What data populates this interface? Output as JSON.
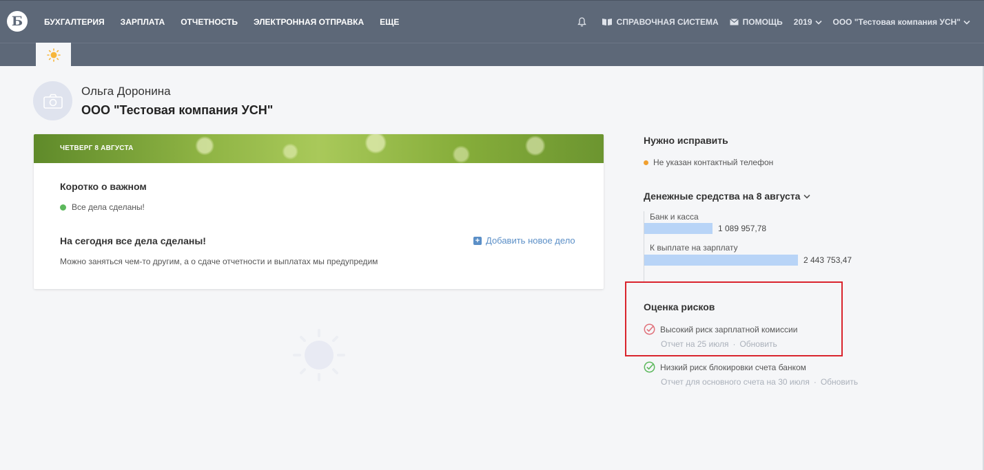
{
  "header": {
    "logo_letter": "Б",
    "nav": [
      "БУХГАЛТЕРИЯ",
      "ЗАРПЛАТА",
      "ОТЧЕТНОСТЬ",
      "ЭЛЕКТРОННАЯ ОТПРАВКА",
      "ЕЩЕ"
    ],
    "reference_label": "СПРАВОЧНАЯ СИСТЕМА",
    "help_label": "ПОМОЩЬ",
    "year": "2019",
    "company": "ООО \"Тестовая компания УСН\""
  },
  "profile": {
    "user_name": "Ольга Доронина",
    "company_name": "ООО \"Тестовая компания УСН\""
  },
  "day_card": {
    "date": "ЧЕТВЕРГ 8 АВГУСТА",
    "important_title": "Коротко о важном",
    "all_done": "Все дела сделаны!",
    "today_title": "На сегодня все дела сделаны!",
    "add_task": "Добавить новое дело",
    "description": "Можно заняться чем-то другим, а о сдаче отчетности и выплатах мы предупредим"
  },
  "fix_panel": {
    "title": "Нужно исправить",
    "item": "Не указан контактный телефон"
  },
  "money_panel": {
    "title": "Денежные средства на 8 августа",
    "bars": [
      {
        "label": "Банк и касса",
        "value": "1 089 957,78",
        "amount": 1089957.78
      },
      {
        "label": "К выплате на зарплату",
        "value": "2 443 753,47",
        "amount": 2443753.47
      }
    ],
    "bar_color": "#b8d4f7"
  },
  "risk_panel": {
    "title": "Оценка рисков",
    "items": [
      {
        "text": "Высокий риск зарплатной комиссии",
        "report": "Отчет на 25 июля",
        "sep": "·",
        "update": "Обновить",
        "color": "#e0707a"
      },
      {
        "text": "Низкий риск блокировки счета банком",
        "report": "Отчет для основного счета на 30 июля",
        "sep": "·",
        "update": "Обновить",
        "color": "#5cb85c"
      }
    ]
  },
  "colors": {
    "topbar": "#5d6878",
    "link": "#5b8fc7",
    "highlight": "#d9232c"
  }
}
